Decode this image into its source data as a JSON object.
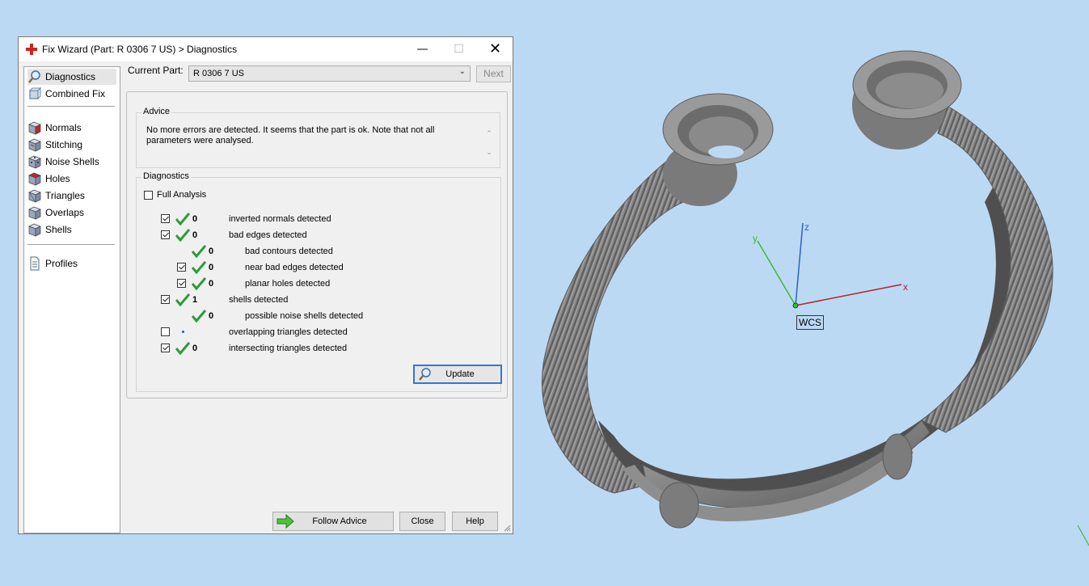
{
  "window": {
    "title": "Fix Wizard (Part: R 0306 7 US) > Diagnostics",
    "minimize_glyph": "—",
    "maximize_glyph": "☐",
    "close_glyph": "✕"
  },
  "sidebar": {
    "items": [
      {
        "label": "Diagnostics",
        "icon": "magnifier-icon",
        "active": true
      },
      {
        "label": "Combined Fix",
        "icon": "combined-fix-icon"
      },
      {
        "label": "Normals",
        "icon": "normals-cube-icon"
      },
      {
        "label": "Stitching",
        "icon": "stitching-cube-icon"
      },
      {
        "label": "Noise Shells",
        "icon": "noise-shells-icon"
      },
      {
        "label": "Holes",
        "icon": "holes-cube-icon"
      },
      {
        "label": "Triangles",
        "icon": "triangles-cube-icon"
      },
      {
        "label": "Overlaps",
        "icon": "overlaps-cube-icon"
      },
      {
        "label": "Shells",
        "icon": "shells-cube-icon"
      },
      {
        "label": "Profiles",
        "icon": "document-icon"
      }
    ]
  },
  "current_part": {
    "label": "Current Part:",
    "value": "R 0306 7 US",
    "next_label": "Next"
  },
  "advice": {
    "title": "Advice",
    "text": "No more errors are detected. It seems that the part is ok. Note that not all parameters were analysed."
  },
  "diagnostics": {
    "title": "Diagnostics",
    "full_analysis_label": "Full Analysis",
    "full_analysis_checked": false,
    "rows": [
      {
        "checkbox": true,
        "checked": true,
        "status": "ok",
        "count": "0",
        "label": "inverted normals detected"
      },
      {
        "checkbox": true,
        "checked": true,
        "status": "ok",
        "count": "0",
        "label": "bad edges detected"
      },
      {
        "checkbox": false,
        "checked": false,
        "status": "ok",
        "count": "0",
        "label": "bad contours detected"
      },
      {
        "checkbox": true,
        "checked": true,
        "status": "ok",
        "count": "0",
        "label": "near bad edges detected"
      },
      {
        "checkbox": true,
        "checked": true,
        "status": "ok",
        "count": "0",
        "label": "planar holes detected"
      },
      {
        "checkbox": true,
        "checked": true,
        "status": "ok",
        "count": "1",
        "label": "shells detected"
      },
      {
        "checkbox": false,
        "checked": false,
        "status": "ok",
        "count": "0",
        "label": "possible noise shells detected"
      },
      {
        "checkbox": true,
        "checked": false,
        "status": "unknown",
        "count": "",
        "label": "overlapping triangles detected"
      },
      {
        "checkbox": true,
        "checked": true,
        "status": "ok",
        "count": "0",
        "label": "intersecting triangles detected"
      }
    ],
    "update_label": "Update"
  },
  "buttons": {
    "follow_advice": "Follow Advice",
    "close": "Close",
    "help": "Help"
  },
  "viewport": {
    "axis_labels": {
      "x": "x",
      "y": "y",
      "z": "z"
    },
    "wcs_label": "WCS",
    "colors": {
      "x_axis": "#b3262a",
      "y_axis": "#3db83a",
      "z_axis": "#2a63c4",
      "background": "#bcd9f4",
      "model": "#8c8c8c"
    }
  },
  "colors": {
    "accent": "#3377d3",
    "ok_tick": "#2e9a3a",
    "app_icon": "#d22020"
  }
}
